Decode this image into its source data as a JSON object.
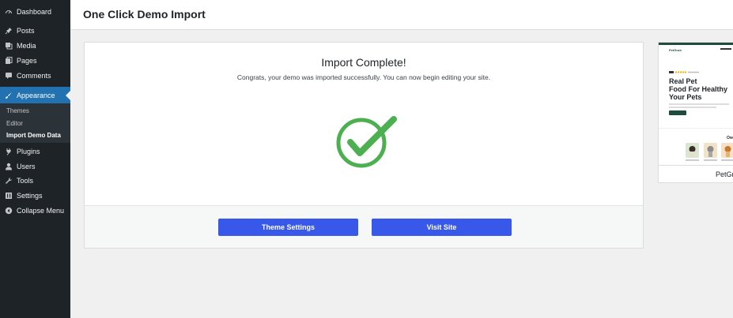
{
  "sidebar": {
    "items": [
      {
        "label": "Dashboard",
        "icon": "dashboard-icon"
      },
      {
        "label": "Posts",
        "icon": "pin-icon"
      },
      {
        "label": "Media",
        "icon": "media-icon"
      },
      {
        "label": "Pages",
        "icon": "pages-icon"
      },
      {
        "label": "Comments",
        "icon": "comment-icon"
      },
      {
        "label": "Appearance",
        "icon": "brush-icon"
      },
      {
        "label": "Plugins",
        "icon": "plug-icon"
      },
      {
        "label": "Users",
        "icon": "user-icon"
      },
      {
        "label": "Tools",
        "icon": "wrench-icon"
      },
      {
        "label": "Settings",
        "icon": "settings-icon"
      },
      {
        "label": "Collapse Menu",
        "icon": "collapse-icon"
      }
    ],
    "submenu": [
      {
        "label": "Themes"
      },
      {
        "label": "Editor"
      },
      {
        "label": "Import Demo Data"
      }
    ],
    "active": "Appearance",
    "current_sub": "Import Demo Data"
  },
  "header": {
    "title": "One Click Demo Import"
  },
  "card": {
    "title": "Import Complete!",
    "message": "Congrats, your demo was imported successfully. You can now begin editing your site.",
    "buttons": {
      "theme_settings": "Theme Settings",
      "visit_site": "Visit Site"
    },
    "check_color": "#4caf50",
    "button_color": "#3858e9"
  },
  "preview": {
    "logo": "PetGrub",
    "headline_line1": "Real Pet",
    "headline_line2": "Food For Healthy",
    "headline_line3": "Your Pets",
    "section_label": "Ow",
    "name": "PetGr"
  },
  "colors": {
    "sidebar_bg": "#1d2327",
    "active_bg": "#2271b1",
    "page_bg": "#f0f0f1"
  }
}
